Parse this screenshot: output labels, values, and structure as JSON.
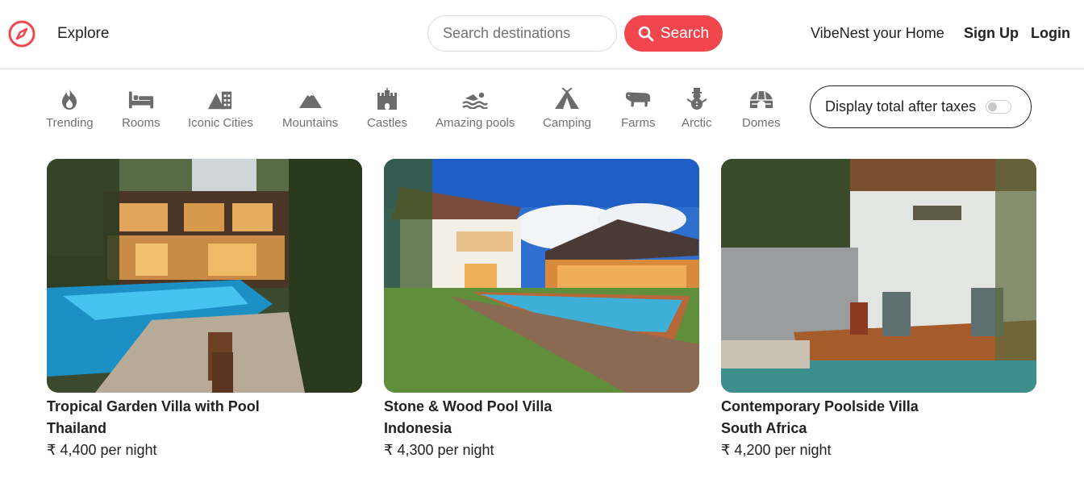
{
  "header": {
    "logo_icon": "compass-icon",
    "explore_label": "Explore",
    "search_placeholder": "Search destinations",
    "search_button_label": "Search",
    "host_link_label": "VibeNest your Home",
    "signup_label": "Sign Up",
    "login_label": "Login",
    "accent_color": "#f2464f"
  },
  "categories": [
    {
      "label": "Trending",
      "icon": "flame-icon"
    },
    {
      "label": "Rooms",
      "icon": "bed-icon"
    },
    {
      "label": "Iconic Cities",
      "icon": "city-icon"
    },
    {
      "label": "Mountains",
      "icon": "mountain-icon"
    },
    {
      "label": "Castles",
      "icon": "castle-icon"
    },
    {
      "label": "Amazing pools",
      "icon": "swimmer-icon"
    },
    {
      "label": "Camping",
      "icon": "tent-icon"
    },
    {
      "label": "Farms",
      "icon": "cow-icon"
    },
    {
      "label": "Arctic",
      "icon": "snowman-icon"
    },
    {
      "label": "Domes",
      "icon": "igloo-icon"
    }
  ],
  "tax_toggle": {
    "label": "Display total after taxes",
    "enabled": false
  },
  "listings": [
    {
      "title": "Tropical Garden Villa with Pool",
      "country": "Thailand",
      "price": "₹ 4,400 per night",
      "image": "villa-photo"
    },
    {
      "title": "Stone & Wood Pool Villa",
      "country": "Indonesia",
      "price": "₹ 4,300 per night",
      "image": "villa-photo"
    },
    {
      "title": "Contemporary Poolside Villa",
      "country": "South Africa",
      "price": "₹ 4,200 per night",
      "image": "villa-photo"
    }
  ]
}
